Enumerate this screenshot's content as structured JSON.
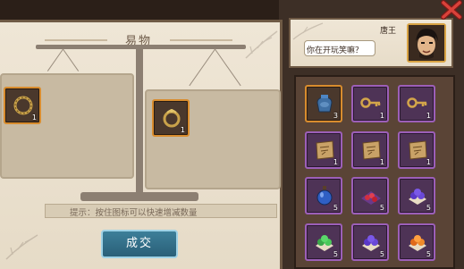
{
  "trade_panel": {
    "title": "易物",
    "left_item": {
      "icon": "ring-icon",
      "count": "1"
    },
    "right_item": {
      "icon": "ornate-ring-icon",
      "count": "1"
    },
    "hint": "提示：按住图标可以快速增减数量",
    "confirm_label": "成交"
  },
  "npc": {
    "name": "唐王",
    "speech": "你在开玩笑嘛？",
    "portrait_icon": "npc-portrait-icon"
  },
  "inventory": {
    "items": [
      {
        "icon": "blue-pot-icon",
        "count": "3",
        "frame": "orange"
      },
      {
        "icon": "key-icon",
        "count": "1",
        "frame": "purple"
      },
      {
        "icon": "key-icon",
        "count": "1",
        "frame": "purple"
      },
      {
        "icon": "map-scroll-icon",
        "count": "1",
        "frame": "purple"
      },
      {
        "icon": "map-scroll-icon",
        "count": "1",
        "frame": "purple"
      },
      {
        "icon": "map-scroll-icon",
        "count": "1",
        "frame": "purple"
      },
      {
        "icon": "blue-potion-bottle-icon",
        "count": "5",
        "frame": "purple"
      },
      {
        "icon": "red-gem-tray-icon",
        "count": "5",
        "frame": "purple"
      },
      {
        "icon": "purple-gems-icon",
        "count": "5",
        "frame": "purple"
      },
      {
        "icon": "green-gems-icon",
        "count": "5",
        "frame": "purple"
      },
      {
        "icon": "purple-gems-icon",
        "count": "5",
        "frame": "purple"
      },
      {
        "icon": "orange-gems-icon",
        "count": "5",
        "frame": "purple"
      }
    ]
  },
  "colors": {
    "accent_orange": "#d88c2e",
    "accent_purple": "#9c5fb8",
    "button_blue": "#2a5f78"
  }
}
